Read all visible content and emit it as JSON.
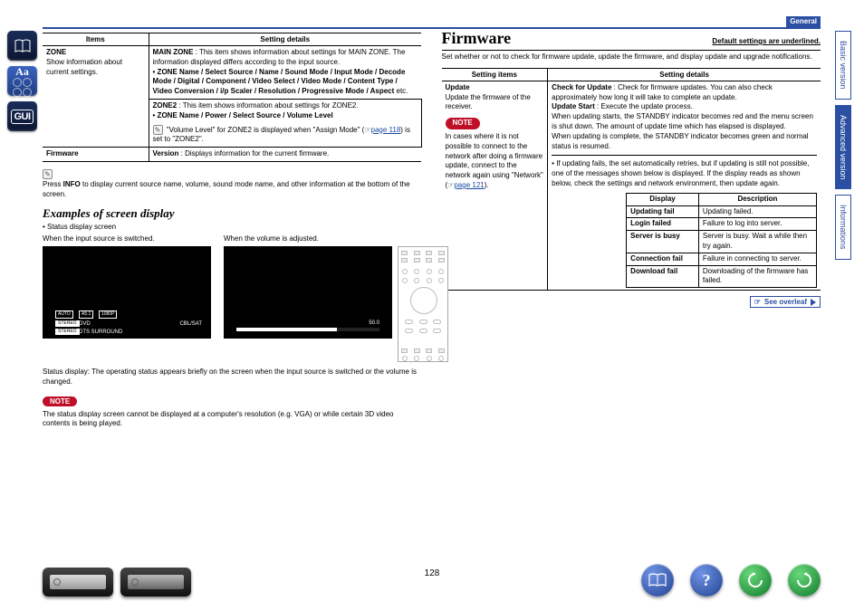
{
  "header": {
    "section_label": "General"
  },
  "side_tabs": {
    "basic": "Basic version",
    "advanced": "Advanced version",
    "info": "Informations"
  },
  "left_icons": {
    "book": "book-icon",
    "aa": "Aa",
    "gui": "GUI"
  },
  "table_zone": {
    "head_items": "Items",
    "head_details": "Setting details",
    "rows": [
      {
        "item_title": "ZONE",
        "item_desc": "Show information about current settings.",
        "main_label": "MAIN ZONE",
        "main_text": " : This item shows information about settings for MAIN ZONE. The information displayed differs according to the input source.",
        "main_bullet_prefix": "• ZONE Name",
        "main_bullet_rest": " / Select Source / Name / Sound Mode / Input Mode / Decode Mode / Digital / Component / Video Select / Video Mode / Content Type / Video Conversion / i/p Scaler / Resolution / Progressive Mode / Aspect",
        "main_bullet_etc": " etc.",
        "zone2_label": "ZONE2",
        "zone2_text": " : This item shows information about settings for ZONE2.",
        "zone2_bullet": "• ZONE Name / Power / Select Source / Volume Level",
        "vol_note_a": "\"Volume Level\" for ZONE2 is displayed when \"Assign Mode\" (",
        "vol_link": "page 118",
        "vol_note_b": ") is set to \"ZONE2\"."
      },
      {
        "item_title": "Firmware",
        "ver_label": "Version",
        "ver_text": " : Displays information for the current firmware."
      }
    ]
  },
  "info_text_a": "Press ",
  "info_text_bold": "INFO",
  "info_text_b": " to display current source name, volume, sound mode name, and other information at the bottom of the screen.",
  "examples": {
    "heading": "Examples of screen display",
    "bullet": "• Status display screen",
    "cap1": "When the input source is switched.",
    "cap2": "When the volume is adjusted.",
    "d1": {
      "auto": "AUTO",
      "a51": "A5.1",
      "v1080": "1080P",
      "dvd": "DVD",
      "cbl": "CBL/SAT",
      "stereo": "STEREO",
      "dts": "DTS SURROUND"
    },
    "d2": {
      "vol": "50.0"
    },
    "status_note": "Status display: The operating status appears briefly on the screen when the input source is switched or the volume is changed.",
    "note_label": "NOTE",
    "note_body": "The status display screen cannot be displayed at a computer's resolution (e.g. VGA) or while certain 3D video contents is being played."
  },
  "firmware": {
    "heading": "Firmware",
    "default_note": "Default settings are underlined.",
    "intro": "Set whether or not to check for firmware update, update the firmware, and display update and upgrade notifications.",
    "head_items": "Setting items",
    "head_details": "Setting details",
    "row": {
      "item_title": "Update",
      "item_desc": "Update the firmware of the receiver.",
      "note_label": "NOTE",
      "note_body_a": "In cases where it is not possible to connect to the network after doing a firmware update, connect to the network again using \"Network\" (",
      "note_link": "page 121",
      "note_body_b": ").",
      "chk_label": "Check for Update",
      "chk_text": " : Check for firmware updates. You can also check approximately how long it will take to complete an update.",
      "start_label": "Update Start",
      "start_text": " : Execute the update process.",
      "p1": "When updating starts, the STANDBY indicator becomes red and the menu screen is shut down. The amount of update time which has elapsed is displayed.",
      "p2": "When updating is complete, the STANDBY indicator becomes green and normal status is resumed.",
      "fail_intro": "• If updating fails, the set automatically retries, but if updating is still not possible, one of the messages shown below is displayed. If the display reads as shown below, check the settings and network environment, then update again."
    },
    "msg_table": {
      "h1": "Display",
      "h2": "Description",
      "r": [
        {
          "d": "Updating fail",
          "t": "Updating failed."
        },
        {
          "d": "Login failed",
          "t": "Failure to log into server."
        },
        {
          "d": "Server is busy",
          "t": "Server is busy. Wait a while then try again."
        },
        {
          "d": "Connection fail",
          "t": "Failure in connecting to server."
        },
        {
          "d": "Download fail",
          "t": "Downloading of the firmware has failed."
        }
      ]
    },
    "see_overleaf": "See overleaf"
  },
  "page_number": "128"
}
